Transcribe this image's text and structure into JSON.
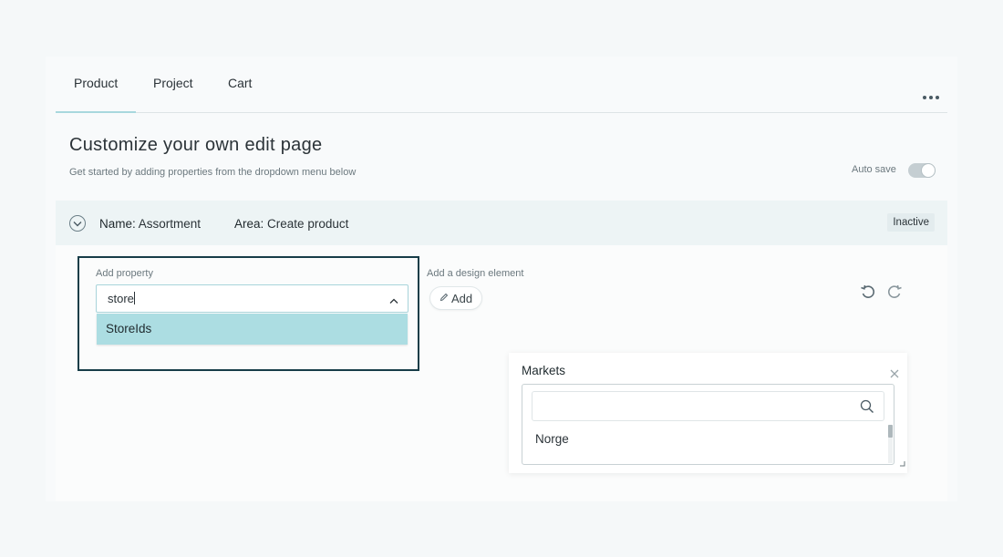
{
  "tabs": [
    {
      "label": "Product",
      "active": true
    },
    {
      "label": "Project",
      "active": false
    },
    {
      "label": "Cart",
      "active": false
    }
  ],
  "header": {
    "title": "Customize your own edit page",
    "subtitle": "Get started by adding properties from the dropdown menu below",
    "autosave_label": "Auto save"
  },
  "section": {
    "name_key": "Name:",
    "name_value": "Assortment",
    "area_key": "Area:",
    "area_value": "Create product",
    "status": "Inactive"
  },
  "property": {
    "label": "Add property",
    "input_value": "store",
    "options": [
      "StoreIds"
    ]
  },
  "design": {
    "label": "Add a design element",
    "add_label": "Add"
  },
  "markets": {
    "title": "Markets",
    "search_value": "",
    "items": [
      "Norge"
    ]
  },
  "colors": {
    "accent": "#a8d8de",
    "option_highlight": "#acdde2",
    "focus_border": "#173d48"
  },
  "icons": [
    "more-icon",
    "chevron-down-icon",
    "chevron-up-icon",
    "pencil-icon",
    "undo-icon",
    "redo-icon",
    "close-icon",
    "search-icon",
    "resize-handle-icon"
  ]
}
